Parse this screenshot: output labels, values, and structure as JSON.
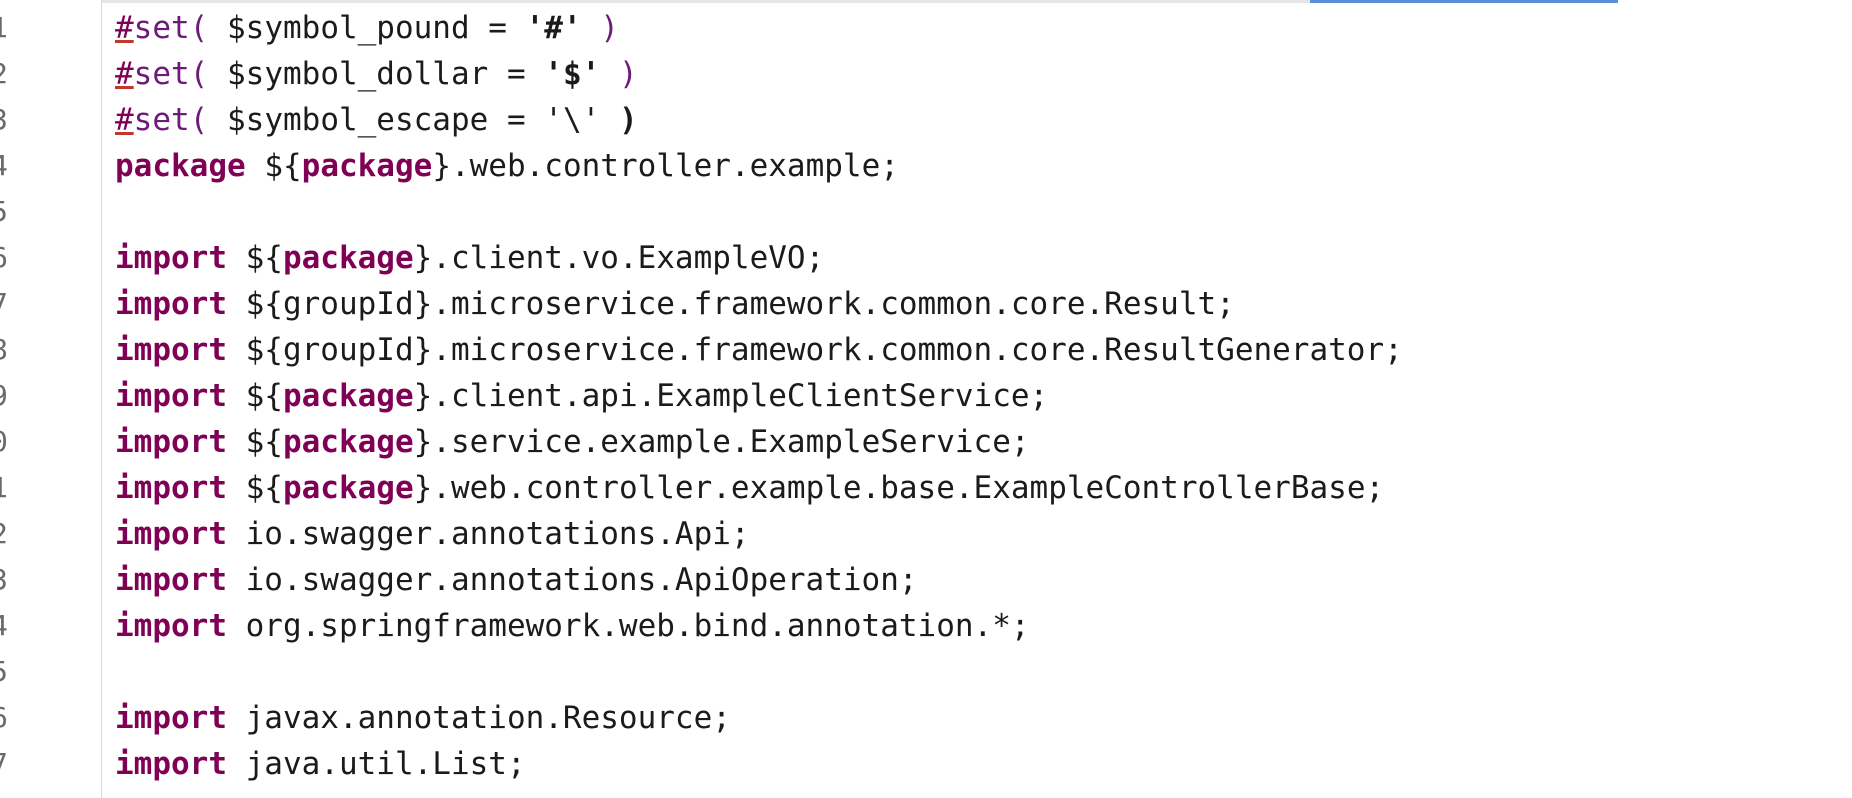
{
  "editor": {
    "lines": [
      {
        "n": "1",
        "tokens": [
          {
            "t": "#",
            "c": "warn"
          },
          {
            "t": "set",
            "c": "vm"
          },
          {
            "t": "( ",
            "c": "vm"
          },
          {
            "t": "$symbol_pound = ",
            "c": ""
          },
          {
            "t": "'#'",
            "c": "str"
          },
          {
            "t": " )",
            "c": "vm"
          }
        ]
      },
      {
        "n": "2",
        "tokens": [
          {
            "t": "#",
            "c": "warn"
          },
          {
            "t": "set",
            "c": "vm"
          },
          {
            "t": "( ",
            "c": "vm"
          },
          {
            "t": "$symbol_dollar = ",
            "c": ""
          },
          {
            "t": "'$'",
            "c": "str"
          },
          {
            "t": " )",
            "c": "vm"
          }
        ]
      },
      {
        "n": "3",
        "tokens": [
          {
            "t": "#",
            "c": "warn"
          },
          {
            "t": "set",
            "c": "vm"
          },
          {
            "t": "( ",
            "c": "vm"
          },
          {
            "t": "$symbol_escape = ",
            "c": ""
          },
          {
            "t": "'\\'",
            "c": ""
          },
          {
            "t": " )",
            "c": "str"
          }
        ]
      },
      {
        "n": "4",
        "tokens": [
          {
            "t": "package",
            "c": "kw"
          },
          {
            "t": " ${",
            "c": ""
          },
          {
            "t": "package",
            "c": "kw"
          },
          {
            "t": "}.web.controller.example;",
            "c": ""
          }
        ]
      },
      {
        "n": "5",
        "tokens": []
      },
      {
        "n": "6",
        "tokens": [
          {
            "t": "import",
            "c": "kw"
          },
          {
            "t": " ${",
            "c": ""
          },
          {
            "t": "package",
            "c": "kw"
          },
          {
            "t": "}.client.vo.ExampleVO;",
            "c": ""
          }
        ]
      },
      {
        "n": "7",
        "tokens": [
          {
            "t": "import",
            "c": "kw"
          },
          {
            "t": " ${groupId}.microservice.framework.common.core.Result;",
            "c": ""
          }
        ]
      },
      {
        "n": "8",
        "tokens": [
          {
            "t": "import",
            "c": "kw"
          },
          {
            "t": " ${groupId}.microservice.framework.common.core.ResultGenerator;",
            "c": ""
          }
        ]
      },
      {
        "n": "9",
        "tokens": [
          {
            "t": "import",
            "c": "kw"
          },
          {
            "t": " ${",
            "c": ""
          },
          {
            "t": "package",
            "c": "kw"
          },
          {
            "t": "}.client.api.ExampleClientService;",
            "c": ""
          }
        ]
      },
      {
        "n": "0",
        "tokens": [
          {
            "t": "import",
            "c": "kw"
          },
          {
            "t": " ${",
            "c": ""
          },
          {
            "t": "package",
            "c": "kw"
          },
          {
            "t": "}.service.example.ExampleService;",
            "c": ""
          }
        ]
      },
      {
        "n": "1",
        "tokens": [
          {
            "t": "import",
            "c": "kw"
          },
          {
            "t": " ${",
            "c": ""
          },
          {
            "t": "package",
            "c": "kw"
          },
          {
            "t": "}.web.controller.example.base.ExampleControllerBase;",
            "c": ""
          }
        ]
      },
      {
        "n": "2",
        "tokens": [
          {
            "t": "import",
            "c": "kw"
          },
          {
            "t": " io.swagger.annotations.Api;",
            "c": ""
          }
        ]
      },
      {
        "n": "3",
        "tokens": [
          {
            "t": "import",
            "c": "kw"
          },
          {
            "t": " io.swagger.annotations.ApiOperation;",
            "c": ""
          }
        ]
      },
      {
        "n": "4",
        "tokens": [
          {
            "t": "import",
            "c": "kw"
          },
          {
            "t": " org.springframework.web.bind.annotation.*;",
            "c": ""
          }
        ]
      },
      {
        "n": "5",
        "tokens": []
      },
      {
        "n": "6",
        "tokens": [
          {
            "t": "import",
            "c": "kw"
          },
          {
            "t": " javax.annotation.Resource;",
            "c": ""
          }
        ]
      },
      {
        "n": "7",
        "tokens": [
          {
            "t": "import",
            "c": "kw"
          },
          {
            "t": " java.util.List;",
            "c": ""
          }
        ]
      }
    ]
  },
  "colors": {
    "keyword": "#7f0055",
    "velocity_directive": "#6e1a7a",
    "text": "#1b1b1b",
    "line_number": "#6a6a6a",
    "active_tab_accent": "#5a8fd6"
  }
}
